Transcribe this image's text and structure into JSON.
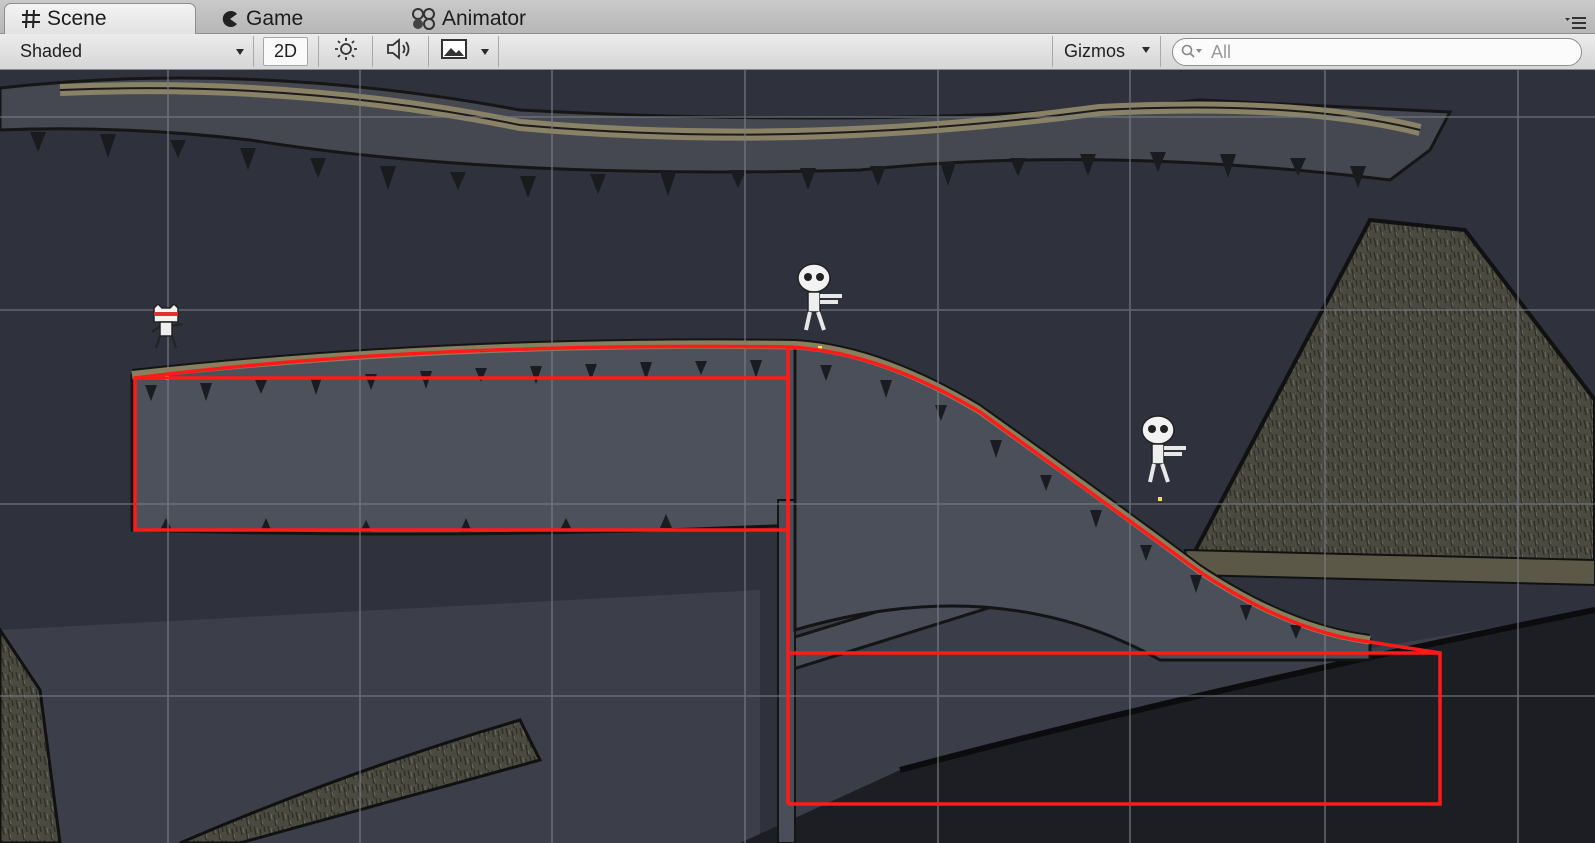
{
  "tabs": [
    {
      "label": "Scene",
      "icon": "grid-icon",
      "active": true
    },
    {
      "label": "Game",
      "icon": "pacman-icon",
      "active": false
    },
    {
      "label": "Animator",
      "icon": "animator-icon",
      "active": false
    }
  ],
  "toolbar": {
    "draw_mode": "Shaded",
    "mode_2d": "2D",
    "lighting_icon": "sun-icon",
    "audio_icon": "speaker-icon",
    "effects_icon": "image-icon",
    "gizmos_label": "Gizmos",
    "search_placeholder": "All"
  },
  "colors": {
    "collider": "#ff1a1a",
    "grid": "#6b6f78",
    "background": "#2e313b"
  }
}
